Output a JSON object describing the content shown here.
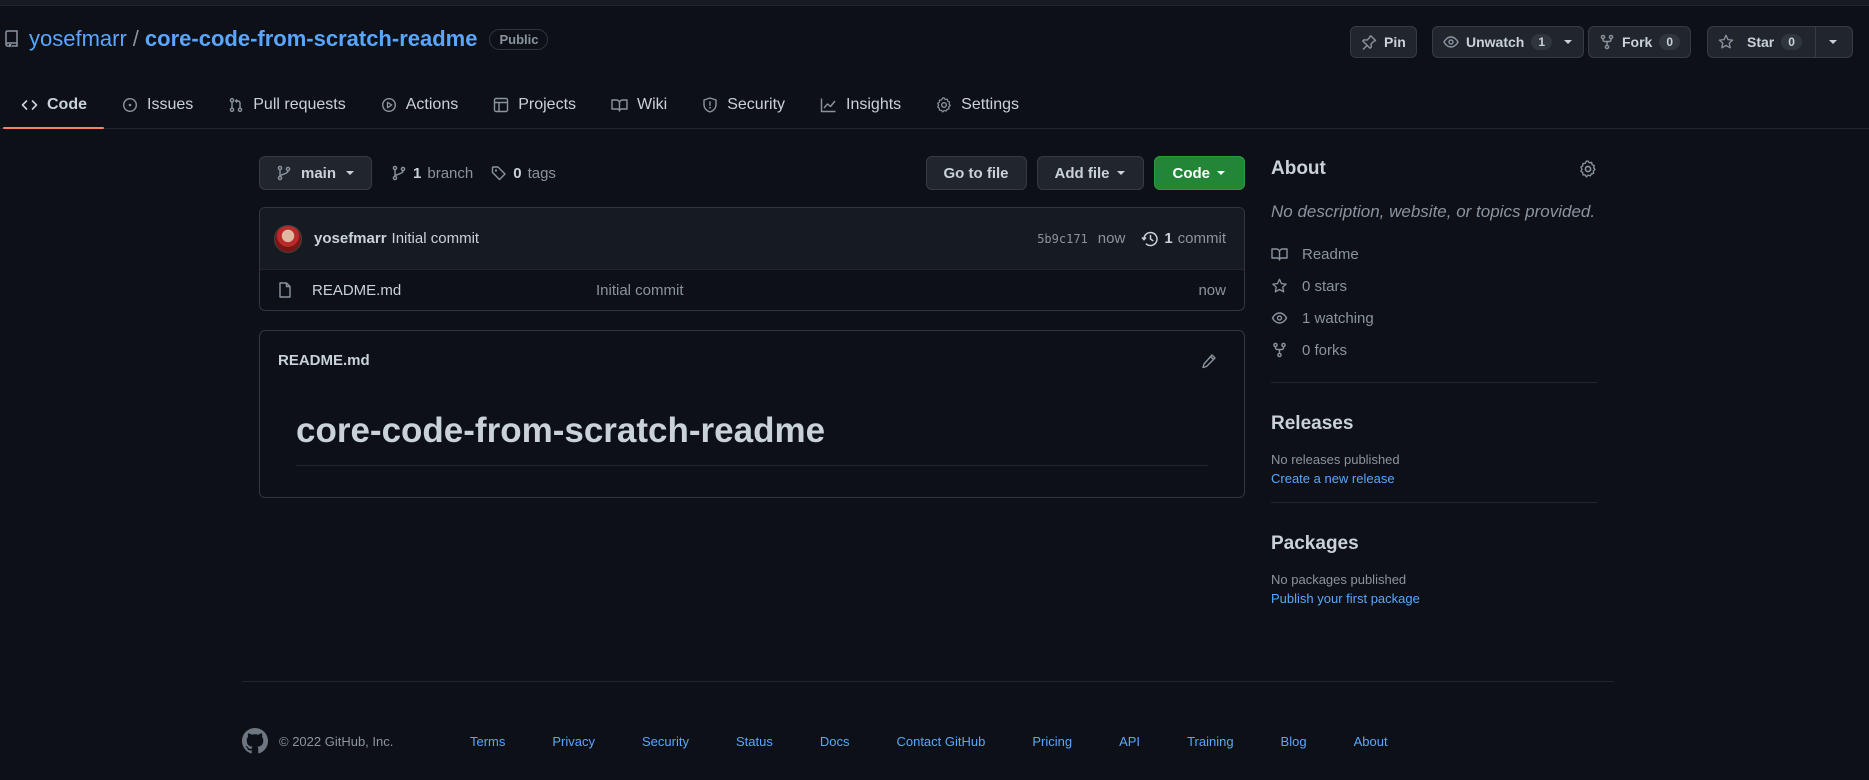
{
  "repo": {
    "owner": "yosefmarr",
    "separator": "/",
    "name": "core-code-from-scratch-readme",
    "visibility": "Public"
  },
  "actions": {
    "pin_label": "Pin",
    "unwatch_label": "Unwatch",
    "watch_count": "1",
    "fork_label": "Fork",
    "fork_count": "0",
    "star_label": "Star",
    "star_count": "0"
  },
  "tabs": [
    {
      "label": "Code",
      "icon": "code-icon",
      "active": true
    },
    {
      "label": "Issues",
      "icon": "issue-icon"
    },
    {
      "label": "Pull requests",
      "icon": "pull-request-icon"
    },
    {
      "label": "Actions",
      "icon": "play-icon"
    },
    {
      "label": "Projects",
      "icon": "table-icon"
    },
    {
      "label": "Wiki",
      "icon": "book-icon"
    },
    {
      "label": "Security",
      "icon": "shield-icon"
    },
    {
      "label": "Insights",
      "icon": "graph-icon"
    },
    {
      "label": "Settings",
      "icon": "gear-icon"
    }
  ],
  "filebar": {
    "branch": "main",
    "branch_count": "1",
    "branch_label": "branch",
    "tag_count": "0",
    "tag_label": "tags",
    "go_to_file": "Go to file",
    "add_file": "Add file",
    "code": "Code"
  },
  "commit": {
    "author": "yosefmarr",
    "message": "Initial commit",
    "sha": "5b9c171",
    "age": "now",
    "commit_count": "1",
    "commit_label": "commit"
  },
  "files": [
    {
      "name": "README.md",
      "message": "Initial commit",
      "age": "now",
      "icon": "file-icon"
    }
  ],
  "readme": {
    "filename": "README.md",
    "heading": "core-code-from-scratch-readme"
  },
  "about": {
    "title": "About",
    "description": "No description, website, or topics provided.",
    "readme_label": "Readme",
    "stars": "0",
    "stars_label": "stars",
    "watching": "1",
    "watching_label": "watching",
    "forks": "0",
    "forks_label": "forks"
  },
  "releases": {
    "title": "Releases",
    "empty": "No releases published",
    "link": "Create a new release"
  },
  "packages": {
    "title": "Packages",
    "empty": "No packages published",
    "link": "Publish your first package"
  },
  "footer": {
    "copyright": "© 2022 GitHub, Inc.",
    "links": [
      "Terms",
      "Privacy",
      "Security",
      "Status",
      "Docs",
      "Contact GitHub",
      "Pricing",
      "API",
      "Training",
      "Blog",
      "About"
    ]
  },
  "colors": {
    "background": "#0d1117",
    "link": "#58a6ff",
    "green_button": "#238636",
    "active_tab_underline": "#f78166"
  }
}
